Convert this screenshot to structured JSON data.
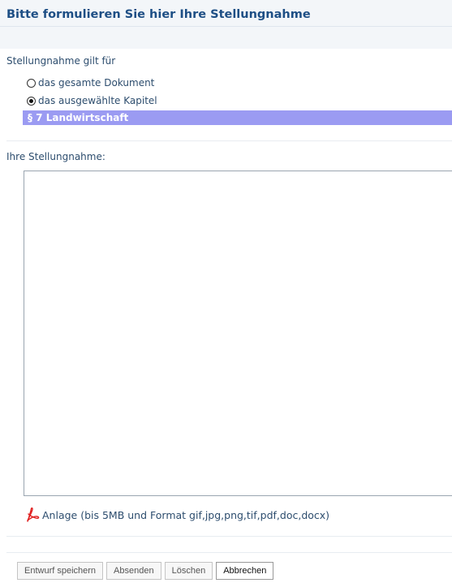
{
  "form": {
    "title": "Bitte formulieren Sie hier Ihre Stellungnahme"
  },
  "scope": {
    "label": "Stellungnahme gilt für",
    "options": [
      {
        "label": "das gesamte Dokument",
        "checked": false
      },
      {
        "label": "das ausgewählte Kapitel",
        "checked": true
      }
    ],
    "chapter": "§ 7 Landwirtschaft"
  },
  "comment": {
    "label": "Ihre Stellungnahme:",
    "value": ""
  },
  "attachment": {
    "label": "Anlage (bis 5MB und Format gif,jpg,png,tif,pdf,doc,docx)",
    "icon": "pdf-icon"
  },
  "buttons": {
    "save_draft": "Entwurf speichern",
    "submit": "Absenden",
    "delete": "Löschen",
    "cancel": "Abbrechen"
  },
  "colors": {
    "title": "#1e4f85",
    "text": "#2d4d6e",
    "chapter_bar": "#9b9bf2",
    "pdf_icon": "#e02020"
  }
}
